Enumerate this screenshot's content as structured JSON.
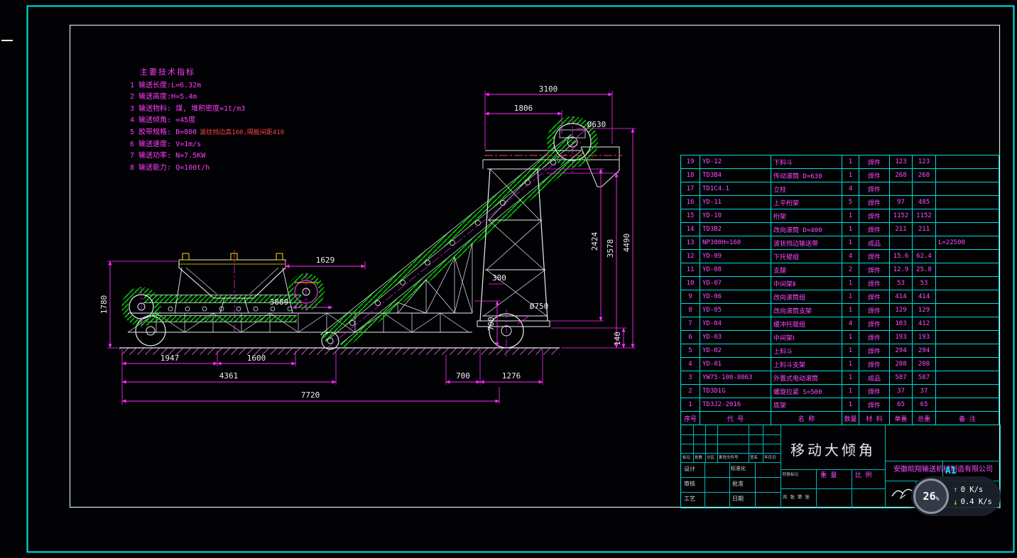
{
  "specs": {
    "title": "主要技术指标",
    "items": [
      {
        "text": "1 输送长度:L=6.32m",
        "note": ""
      },
      {
        "text": "2 输送高度:H=5.4m",
        "note": ""
      },
      {
        "text": "3 输送物料: 煤, 堆积密度=1t/m3",
        "note": ""
      },
      {
        "text": "4 输送倾角: =45度",
        "note": ""
      },
      {
        "text": "5 胶带规格: B=800",
        "note": "波纹挡边高160,隔板间距410"
      },
      {
        "text": "6 输送速度: V=1m/s",
        "note": ""
      },
      {
        "text": "7 输送功率: N=7.5KW",
        "note": ""
      },
      {
        "text": "8 输送能力: Q=100t/h",
        "note": ""
      }
    ]
  },
  "dims": {
    "d3100": "3100",
    "d1806": "1806",
    "d630": "Ø630",
    "d2424": "2424",
    "d3578": "3578",
    "d4490": "4490",
    "d1629": "1629",
    "d1780": "1780",
    "d3889": "3889",
    "d300": "300",
    "d700v": "700",
    "d750": "Ø750",
    "d140": "140",
    "d1947": "1947",
    "d1600": "1600",
    "d4361": "4361",
    "d700h": "700",
    "d1276": "1276",
    "d7720": "7720"
  },
  "bom": {
    "headers": [
      "序号",
      "代  号",
      "名  称",
      "数量",
      "材 料",
      "单重",
      "总重",
      "备  注"
    ],
    "rows": [
      {
        "no": "19",
        "code": "YD-12",
        "name": "下料斗",
        "qty": "1",
        "mat": "焊件",
        "unit": "123",
        "total": "123",
        "note": ""
      },
      {
        "no": "18",
        "code": "TD3B4",
        "name": "传动滚筒 D=630",
        "qty": "1",
        "mat": "焊件",
        "unit": "268",
        "total": "268",
        "note": ""
      },
      {
        "no": "17",
        "code": "TD1C4.1",
        "name": "立柱",
        "qty": "4",
        "mat": "焊件",
        "unit": "",
        "total": "",
        "note": ""
      },
      {
        "no": "16",
        "code": "YD-11",
        "name": "上平桁架",
        "qty": "5",
        "mat": "焊件",
        "unit": "97",
        "total": "485",
        "note": ""
      },
      {
        "no": "15",
        "code": "YD-10",
        "name": "桁架",
        "qty": "1",
        "mat": "焊件",
        "unit": "1152",
        "total": "1152",
        "note": ""
      },
      {
        "no": "14",
        "code": "TD3B2",
        "name": "改向滚筒 D=400",
        "qty": "1",
        "mat": "焊件",
        "unit": "211",
        "total": "211",
        "note": ""
      },
      {
        "no": "13",
        "code": "NP300H=160",
        "name": "波状挡边输送带",
        "qty": "1",
        "mat": "成品",
        "unit": "",
        "total": "",
        "note": "L=22500"
      },
      {
        "no": "12",
        "code": "YD-09",
        "name": "下托辊组",
        "qty": "4",
        "mat": "焊件",
        "unit": "15.6",
        "total": "62.4",
        "note": ""
      },
      {
        "no": "11",
        "code": "YD-08",
        "name": "支腿",
        "qty": "2",
        "mat": "焊件",
        "unit": "12.9",
        "total": "25.8",
        "note": ""
      },
      {
        "no": "10",
        "code": "YD-07",
        "name": "中间架Ⅱ",
        "qty": "1",
        "mat": "焊件",
        "unit": "53",
        "total": "53",
        "note": ""
      },
      {
        "no": "9",
        "code": "YD-06",
        "name": "改向滚筒组",
        "qty": "1",
        "mat": "焊件",
        "unit": "414",
        "total": "414",
        "note": ""
      },
      {
        "no": "8",
        "code": "YD-05",
        "name": "改向滚筒支架",
        "qty": "1",
        "mat": "焊件",
        "unit": "129",
        "total": "129",
        "note": ""
      },
      {
        "no": "7",
        "code": "YD-04",
        "name": "缓冲托辊组",
        "qty": "4",
        "mat": "焊件",
        "unit": "103",
        "total": "412",
        "note": ""
      },
      {
        "no": "6",
        "code": "YD-03",
        "name": "中间架Ⅰ",
        "qty": "1",
        "mat": "焊件",
        "unit": "193",
        "total": "193",
        "note": ""
      },
      {
        "no": "5",
        "code": "YD-02",
        "name": "上料斗",
        "qty": "1",
        "mat": "焊件",
        "unit": "294",
        "total": "294",
        "note": ""
      },
      {
        "no": "4",
        "code": "YD-01",
        "name": "上料斗支架",
        "qty": "1",
        "mat": "焊件",
        "unit": "208",
        "total": "208",
        "note": ""
      },
      {
        "no": "3",
        "code": "YW75-100-8063",
        "name": "外置式电动滚筒",
        "qty": "1",
        "mat": "成品",
        "unit": "587",
        "total": "587",
        "note": ""
      },
      {
        "no": "2",
        "code": "TD3D1G",
        "name": "螺旋拉紧 S=500",
        "qty": "1",
        "mat": "焊件",
        "unit": "37",
        "total": "37",
        "note": ""
      },
      {
        "no": "1",
        "code": "TD3J2-2016",
        "name": "底架",
        "qty": "1",
        "mat": "焊件",
        "unit": "65",
        "total": "65",
        "note": ""
      }
    ]
  },
  "titleblock": {
    "title": "移动大倾角",
    "company": "安徽皖翔输送机械制造有限公司",
    "paper_size": "A1",
    "rev_labels": [
      "标记",
      "处数",
      "分区",
      "更改文件号",
      "签名",
      "年月日"
    ],
    "roles_a": [
      "设计",
      "审核",
      "工艺"
    ],
    "roles_b": [
      "标准化",
      "批准",
      "日期"
    ],
    "stage_label": "阶段标记",
    "weight_label": "重 量",
    "scale_label": "比 例",
    "sheet_label": "共 张 第 张"
  },
  "overlay": {
    "percent": "26",
    "percent_unit": "%",
    "up": "0 K/s",
    "down": "0.4 K/s"
  }
}
